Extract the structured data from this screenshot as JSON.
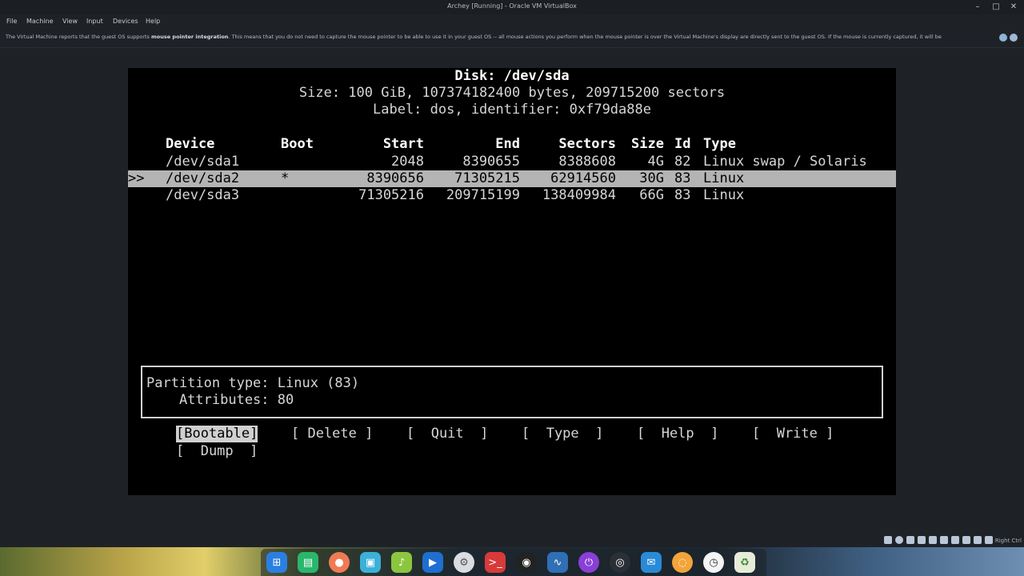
{
  "window": {
    "title": "Archey [Running] - Oracle VM VirtualBox"
  },
  "menu": [
    "File",
    "Machine",
    "View",
    "Input",
    "Devices",
    "Help"
  ],
  "notice": {
    "prefix": "The Virtual Machine reports that the guest OS supports ",
    "bold": "mouse pointer integration",
    "suffix": ". This means that you do not need to capture the mouse pointer to be able to use it in your guest OS -- all mouse actions you perform when the mouse pointer is over the Virtual Machine's display are directly sent to the guest OS. If the mouse is currently captured, it will be"
  },
  "cfdisk": {
    "disk_line": "Disk: /dev/sda",
    "size_line": "Size: 100 GiB, 107374182400 bytes, 209715200 sectors",
    "label_line": "Label: dos, identifier: 0xf79da88e",
    "headers": {
      "device": "Device",
      "boot": "Boot",
      "start": "Start",
      "end": "End",
      "sectors": "Sectors",
      "size": "Size",
      "id": "Id",
      "type": "Type"
    },
    "rows": [
      {
        "marker": "",
        "device": "/dev/sda1",
        "boot": "",
        "start": "2048",
        "end": "8390655",
        "sectors": "8388608",
        "size": "4G",
        "id": "82",
        "type": "Linux swap / Solaris"
      },
      {
        "marker": ">>",
        "device": "/dev/sda2",
        "boot": "*",
        "start": "8390656",
        "end": "71305215",
        "sectors": "62914560",
        "size": "30G",
        "id": "83",
        "type": "Linux"
      },
      {
        "marker": "",
        "device": "/dev/sda3",
        "boot": "",
        "start": "71305216",
        "end": "209715199",
        "sectors": "138409984",
        "size": "66G",
        "id": "83",
        "type": "Linux"
      }
    ],
    "info": {
      "partition_type": "Partition type: Linux (83)",
      "attributes": "    Attributes: 80"
    },
    "buttons": [
      "[Bootable]",
      "[ Delete ]",
      "[  Quit  ]",
      "[  Type  ]",
      "[  Help  ]",
      "[  Write ]",
      "[  Dump  ]"
    ]
  },
  "status": {
    "host_key": "Right Ctrl"
  }
}
